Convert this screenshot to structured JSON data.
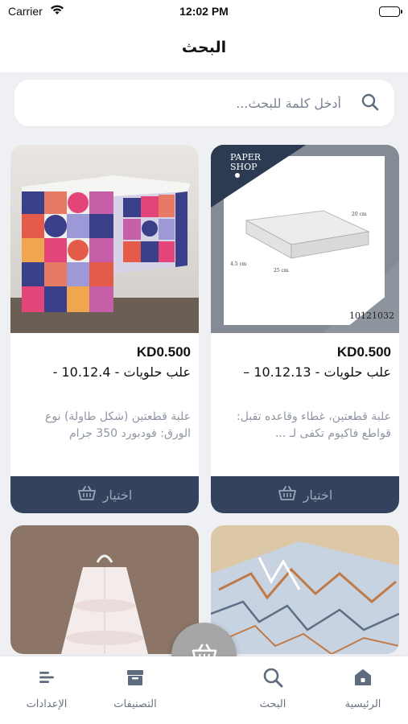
{
  "status_bar": {
    "carrier": "Carrier",
    "time": "12:02 PM"
  },
  "header": {
    "title": "البحث"
  },
  "search": {
    "placeholder": "أدخل كلمة للبحث..."
  },
  "products": [
    {
      "price": "KD0.500",
      "name": "علب حلويات - 10.12.13 –",
      "description": "علبة قطعتين، غطاء وقاعده تقبل: قواطع فاكيوم تكفى لـ ...",
      "select_label": "اختيار",
      "image_code": "10121032",
      "image_brand": "PAPER SHOP",
      "image_dimensions": [
        "20 cm",
        "25 cm",
        "4.5 cm"
      ]
    },
    {
      "price": "KD0.500",
      "name": "علب حلويات - 10.12.4 -",
      "description": "علبة قطعتين (شكل طاولة) نوع الورق: فودبورد 350 جرام",
      "select_label": "اختيار"
    },
    {
      "image": "marble-box"
    },
    {
      "image": "round-tier-box"
    }
  ],
  "tabs": [
    {
      "label": "الرئيسية",
      "icon": "home-icon"
    },
    {
      "label": "البحث",
      "icon": "search-icon"
    },
    {
      "label": "التصنيفات",
      "icon": "categories-icon"
    },
    {
      "label": "الإعدادات",
      "icon": "settings-icon"
    }
  ],
  "cart_fab": {
    "icon": "basket-icon"
  },
  "colors": {
    "accent": "#33435e",
    "fab": "#a6a6a6",
    "background": "#eef0f4"
  }
}
